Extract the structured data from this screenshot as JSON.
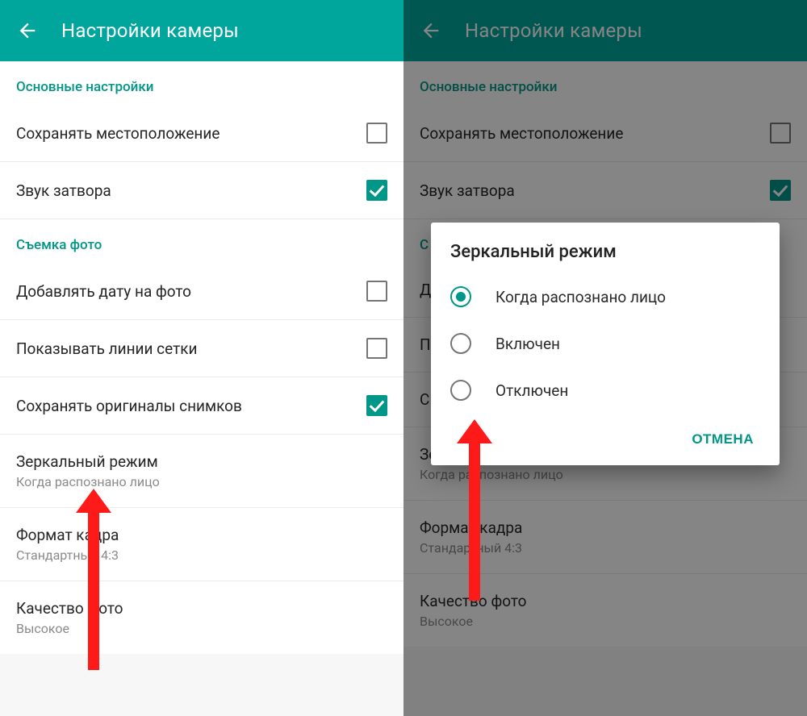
{
  "colors": {
    "accent": "#009688",
    "header": "#00a69c"
  },
  "left": {
    "header": {
      "title": "Настройки камеры"
    },
    "section1": {
      "label": "Основные настройки"
    },
    "save_location": {
      "title": "Сохранять местоположение",
      "checked": false
    },
    "shutter_sound": {
      "title": "Звук затвора",
      "checked": true
    },
    "section2": {
      "label": "Съемка фото"
    },
    "add_date": {
      "title": "Добавлять дату на фото",
      "checked": false
    },
    "grid_lines": {
      "title": "Показывать линии сетки",
      "checked": false
    },
    "save_originals": {
      "title": "Сохранять оригиналы снимков",
      "checked": true
    },
    "mirror_mode": {
      "title": "Зеркальный режим",
      "subtitle": "Когда распознано лицо"
    },
    "aspect_ratio": {
      "title": "Формат кадра",
      "subtitle": "Стандартный 4:3"
    },
    "photo_quality": {
      "title": "Качество фото",
      "subtitle": "Высокое"
    }
  },
  "right": {
    "header": {
      "title": "Настройки камеры"
    },
    "section1": {
      "label": "Основные настройки"
    },
    "save_location": {
      "title": "Сохранять местоположение",
      "checked": false
    },
    "shutter_sound": {
      "title": "Звук затвора",
      "checked": true
    },
    "mirror_mode": {
      "title": "Зеркальный режим",
      "subtitle": "Когда распознано лицо"
    },
    "aspect_ratio": {
      "title": "Формат кадра",
      "subtitle": "Стандартный 4:3"
    },
    "photo_quality": {
      "title": "Качество фото",
      "subtitle": "Высокое"
    },
    "dialog": {
      "title": "Зеркальный режим",
      "options": [
        {
          "label": "Когда распознано лицо",
          "selected": true
        },
        {
          "label": "Включен",
          "selected": false
        },
        {
          "label": "Отключен",
          "selected": false
        }
      ],
      "cancel": "ОТМЕНА"
    }
  }
}
